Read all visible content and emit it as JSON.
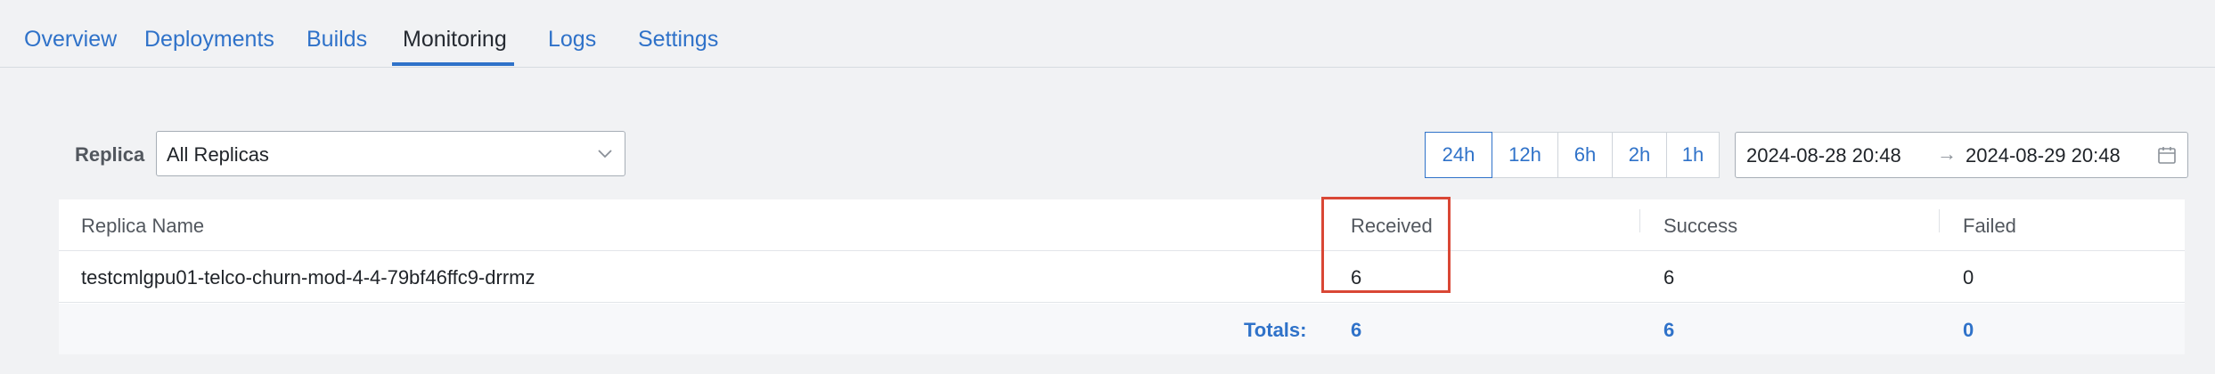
{
  "tabs": [
    {
      "label": "Overview"
    },
    {
      "label": "Deployments"
    },
    {
      "label": "Builds"
    },
    {
      "label": "Monitoring"
    },
    {
      "label": "Logs"
    },
    {
      "label": "Settings"
    }
  ],
  "active_tab": "Monitoring",
  "filters": {
    "replica_label": "Replica",
    "replica_selected": "All Replicas",
    "time_ranges": [
      "24h",
      "12h",
      "6h",
      "2h",
      "1h"
    ],
    "selected_range": "24h",
    "date_start": "2024-08-28 20:48",
    "date_end": "2024-08-29 20:48",
    "date_arrow": "→"
  },
  "table": {
    "columns": [
      "Replica Name",
      "Received",
      "Success",
      "Failed"
    ],
    "rows": [
      {
        "replica_name": "testcmlgpu01-telco-churn-mod-4-4-79bf46ffc9-drrmz",
        "received": "6",
        "success": "6",
        "failed": "0"
      }
    ],
    "totals": {
      "label": "Totals:",
      "received": "6",
      "success": "6",
      "failed": "0"
    }
  },
  "colors": {
    "accent": "#2f72c9",
    "highlight": "#d94735",
    "background": "#f1f2f4"
  },
  "icons": [
    "chevron-down-icon",
    "calendar-icon"
  ]
}
